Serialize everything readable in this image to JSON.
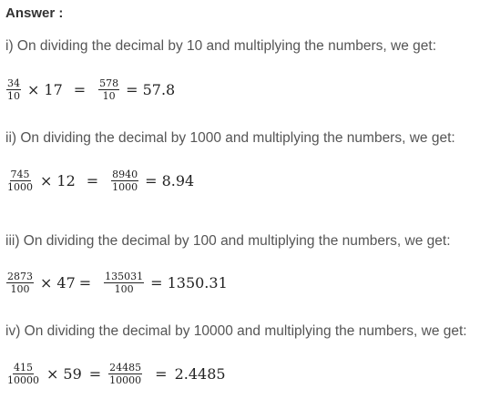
{
  "answer_label": "Answer :",
  "parts": [
    {
      "text": "i) On dividing the decimal by 10 and multiplying the numbers, we get:",
      "f1_num": "34",
      "f1_den": "10",
      "times": "×",
      "mult": "17",
      "eq": "=",
      "f2_num": "578",
      "f2_den": "10",
      "result": "57.8"
    },
    {
      "text": "ii) On dividing the decimal by 1000 and multiplying the numbers, we get:",
      "f1_num": "745",
      "f1_den": "1000",
      "times": "×",
      "mult": "12",
      "eq": "=",
      "f2_num": "8940",
      "f2_den": "1000",
      "result": "8.94"
    },
    {
      "text": "iii) On dividing the decimal by 100 and multiplying the numbers, we get:",
      "f1_num": "2873",
      "f1_den": "100",
      "times": "×",
      "mult": "47",
      "eq": "=",
      "f2_num": "135031",
      "f2_den": "100",
      "result": "1350.31"
    },
    {
      "text": "iv) On dividing the decimal by 10000 and multiplying the numbers, we get:",
      "f1_num": "415",
      "f1_den": "10000",
      "times": "×",
      "mult": "59",
      "eq": "=",
      "f2_num": "24485",
      "f2_den": "10000",
      "result": "2.4485"
    }
  ]
}
